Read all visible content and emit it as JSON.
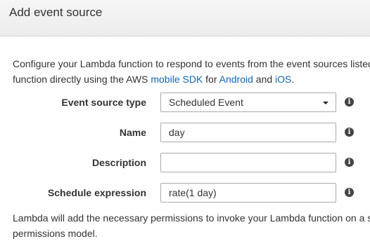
{
  "dialog": {
    "title": "Add event source"
  },
  "intro": {
    "line1": "Configure your Lambda function to respond to events from the event sources listed below. You can also invoke your",
    "line2_prefix": "function directly using the AWS ",
    "mobile_sdk_link": "mobile SDK",
    "line2_for": " for ",
    "android_link": "Android",
    "line2_and": " and ",
    "ios_link": "iOS",
    "line2_end": "."
  },
  "form": {
    "event_source_type": {
      "label": "Event source type",
      "value": "Scheduled Event",
      "info_icon": "info-icon"
    },
    "name": {
      "label": "Name",
      "value": "day",
      "info_icon": "info-icon"
    },
    "description": {
      "label": "Description",
      "value": "",
      "info_icon": "info-icon"
    },
    "schedule_expression": {
      "label": "Schedule expression",
      "value": "rate(1 day)",
      "info_icon": "info-icon"
    }
  },
  "outro": {
    "line1": "Lambda will add the necessary permissions to invoke your Lambda function on a schedule using the resource-based",
    "line2": "permissions model."
  },
  "colors": {
    "link": "#1166bb",
    "text": "#333333",
    "header_bg": "#f0f0f0"
  }
}
